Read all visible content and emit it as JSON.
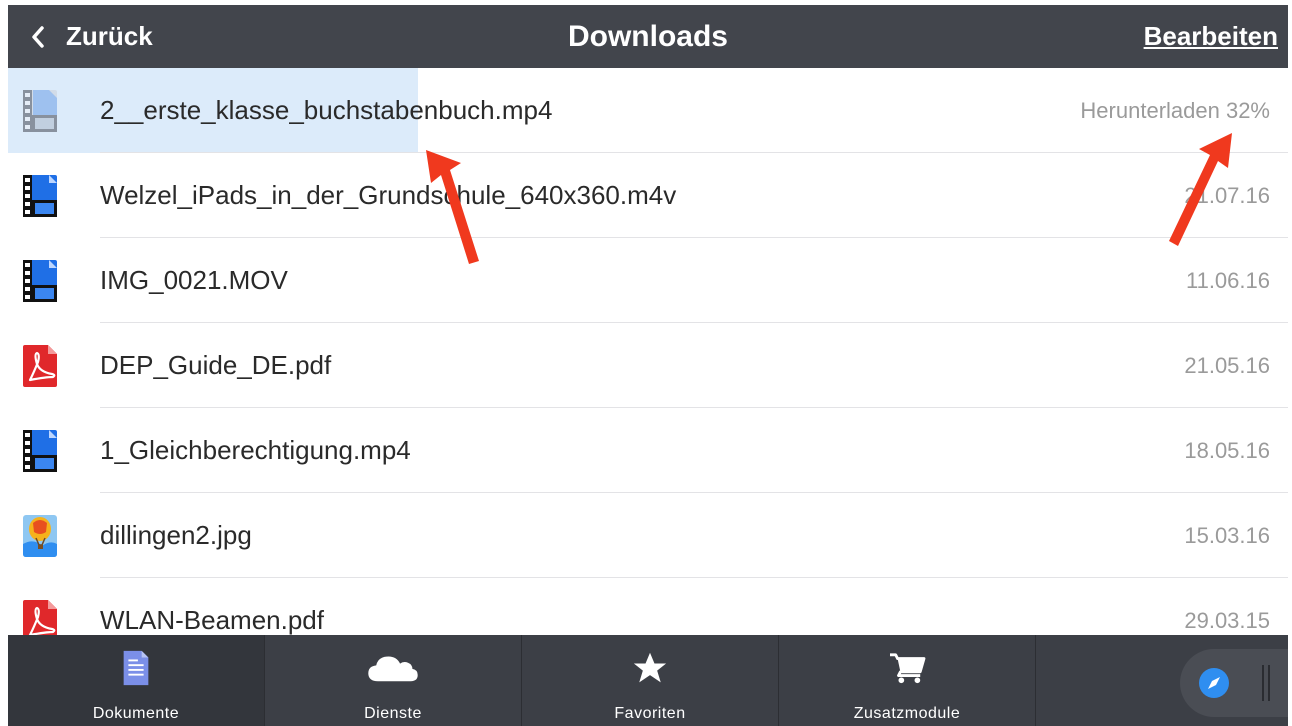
{
  "navbar": {
    "back_label": "Zurück",
    "title": "Downloads",
    "edit_label": "Bearbeiten"
  },
  "files": [
    {
      "name": "2__erste_klasse_buchstabenbuch.mp4",
      "meta": "Herunterladen 32%",
      "icon": "video-file-icon",
      "progress": 0.32
    },
    {
      "name": "Welzel_iPads_in_der_Grundschule_640x360.m4v",
      "meta": "21.07.16",
      "icon": "video-file-icon"
    },
    {
      "name": "IMG_0021.MOV",
      "meta": "11.06.16",
      "icon": "video-file-icon"
    },
    {
      "name": "DEP_Guide_DE.pdf",
      "meta": "21.05.16",
      "icon": "pdf-file-icon"
    },
    {
      "name": "1_Gleichberechtigung.mp4",
      "meta": "18.05.16",
      "icon": "video-file-icon"
    },
    {
      "name": "dillingen2.jpg",
      "meta": "15.03.16",
      "icon": "image-file-icon"
    },
    {
      "name": "WLAN-Beamen.pdf",
      "meta": "29.03.15",
      "icon": "pdf-file-icon"
    }
  ],
  "tabs": [
    {
      "label": "Dokumente",
      "icon": "document-icon",
      "active": true
    },
    {
      "label": "Dienste",
      "icon": "cloud-icon"
    },
    {
      "label": "Favoriten",
      "icon": "star-icon"
    },
    {
      "label": "Zusatzmodule",
      "icon": "cart-icon"
    }
  ],
  "browser_button": {
    "icon": "compass-icon"
  },
  "colors": {
    "navbar_bg": "#42454c",
    "tabbar_bg": "#3c3f46",
    "progress_fill": "#dcebfa",
    "accent_blue": "#2f8ef0",
    "annotation_red": "#f0391e",
    "pdf_red": "#e0282b"
  }
}
